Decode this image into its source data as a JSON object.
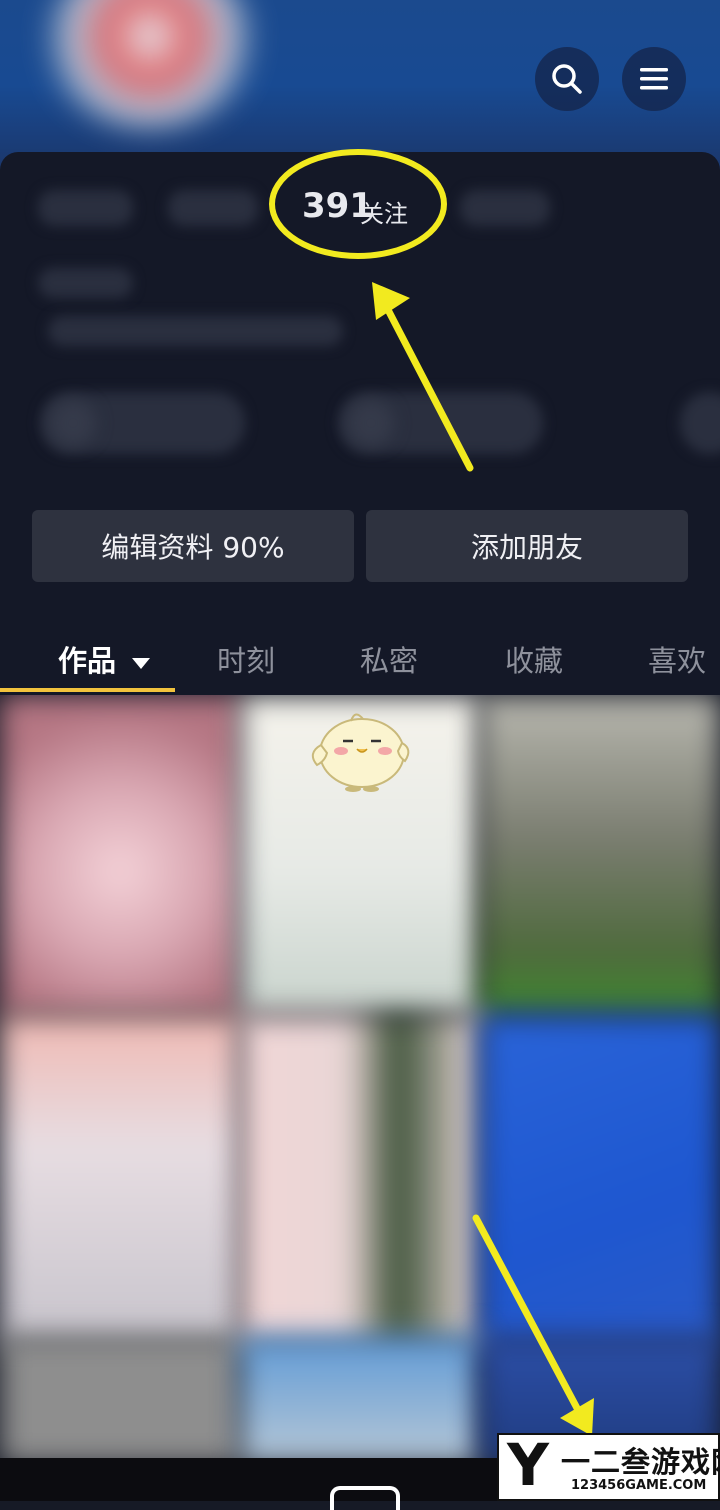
{
  "header": {
    "search_icon": "search-icon",
    "menu_icon": "menu-icon"
  },
  "profile": {
    "follow_count": "391",
    "follow_label": "关注"
  },
  "actions": {
    "edit_profile": "编辑资料 90%",
    "add_friends": "添加朋友"
  },
  "tabs": [
    {
      "label": "作品",
      "active": true
    },
    {
      "label": "时刻"
    },
    {
      "label": "私密"
    },
    {
      "label": "收藏"
    },
    {
      "label": "喜欢"
    }
  ],
  "watermark": {
    "letter": "Y",
    "title": "一二叁游戏网",
    "url": "123456GAME.COM"
  },
  "colors": {
    "highlight": "#f2ea1f",
    "tab_underline": "#f2c33d",
    "panel": "#141827"
  }
}
